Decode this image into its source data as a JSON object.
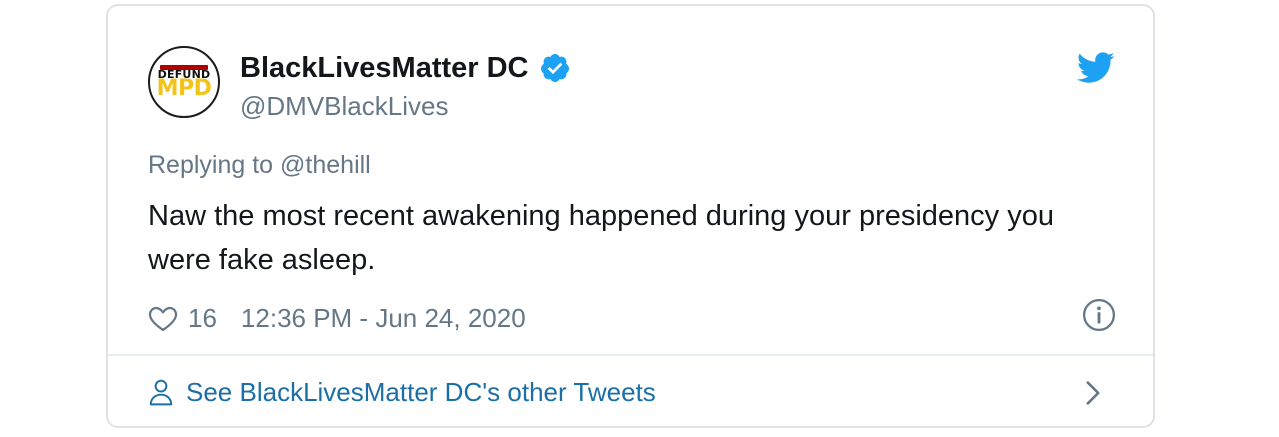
{
  "tweet": {
    "author": {
      "display_name": "BlackLivesMatter DC",
      "handle": "@DMVBlackLives",
      "verified": true,
      "avatar_text_top": "DEFUND",
      "avatar_text_bottom": "MPD"
    },
    "replying_prefix": "Replying to",
    "replying_to": "@thehill",
    "text": "Naw the most recent awakening happened during your presidency you were fake asleep.",
    "like_count": "16",
    "timestamp": "12:36 PM - Jun 24, 2020",
    "footer_link": "See BlackLivesMatter DC's other Tweets"
  },
  "icons": {
    "brand": "twitter-bird-icon",
    "verified": "verified-badge-icon",
    "like": "heart-icon",
    "info": "info-icon",
    "profile": "person-icon",
    "chevron": "chevron-right-icon"
  },
  "colors": {
    "twitter_blue": "#1da1f2",
    "text_primary": "#14171a",
    "text_secondary": "#657786",
    "link": "#1b6fa8",
    "border": "#dfe3e7"
  }
}
